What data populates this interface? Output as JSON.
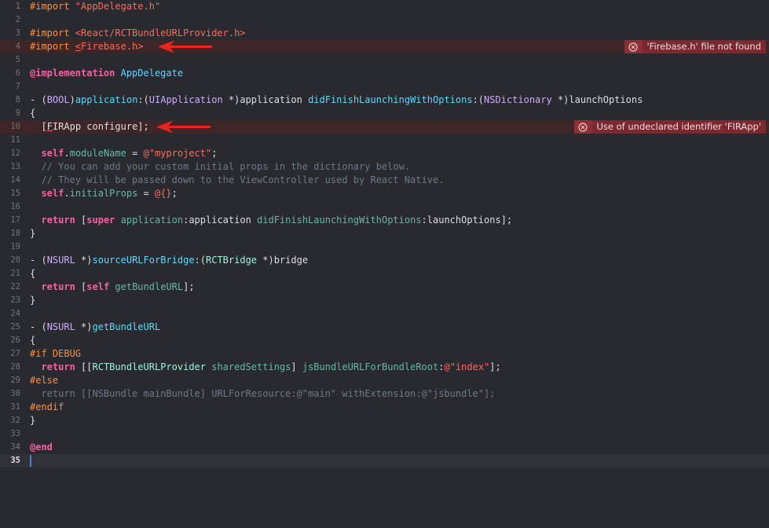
{
  "editor": {
    "lines": [
      {
        "n": "1",
        "tokens": [
          {
            "t": "#import ",
            "c": "pp"
          },
          {
            "t": "\"AppDelegate.h\"",
            "c": "str"
          }
        ]
      },
      {
        "n": "2",
        "tokens": []
      },
      {
        "n": "3",
        "tokens": [
          {
            "t": "#import ",
            "c": "pp"
          },
          {
            "t": "<React/RCTBundleURLProvider.h>",
            "c": "str"
          }
        ]
      },
      {
        "n": "4",
        "error": "'Firebase.h' file not found",
        "tokens": [
          {
            "t": "#import ",
            "c": "pp"
          },
          {
            "t": "<",
            "c": "str umark"
          },
          {
            "t": "Firebase.h>",
            "c": "str"
          }
        ]
      },
      {
        "n": "5",
        "tokens": []
      },
      {
        "n": "6",
        "tokens": [
          {
            "t": "@implementation ",
            "c": "kw"
          },
          {
            "t": "AppDelegate",
            "c": "cls"
          }
        ]
      },
      {
        "n": "7",
        "tokens": []
      },
      {
        "n": "8",
        "tokens": [
          {
            "t": "- (",
            "c": "plain"
          },
          {
            "t": "BOOL",
            "c": "type"
          },
          {
            "t": ")",
            "c": "plain"
          },
          {
            "t": "application",
            "c": "cls"
          },
          {
            "t": ":(",
            "c": "plain"
          },
          {
            "t": "UIApplication",
            "c": "type"
          },
          {
            "t": " *)application ",
            "c": "plain"
          },
          {
            "t": "didFinishLaunchingWithOptions",
            "c": "cls"
          },
          {
            "t": ":(",
            "c": "plain"
          },
          {
            "t": "NSDictionary",
            "c": "type"
          },
          {
            "t": " *)launchOptions",
            "c": "plain"
          }
        ]
      },
      {
        "n": "9",
        "tokens": [
          {
            "t": "{",
            "c": "plain"
          }
        ]
      },
      {
        "n": "10",
        "error": "Use of undeclared identifier 'FIRApp'",
        "tokens": [
          {
            "t": "  [",
            "c": "plain"
          },
          {
            "t": "F",
            "c": "plain umark"
          },
          {
            "t": "IRApp configure];",
            "c": "plain"
          }
        ]
      },
      {
        "n": "11",
        "tokens": []
      },
      {
        "n": "12",
        "tokens": [
          {
            "t": "  ",
            "c": "plain"
          },
          {
            "t": "self",
            "c": "kw"
          },
          {
            "t": ".",
            "c": "plain"
          },
          {
            "t": "moduleName",
            "c": "meth"
          },
          {
            "t": " = ",
            "c": "plain"
          },
          {
            "t": "@\"myproject\"",
            "c": "str"
          },
          {
            "t": ";",
            "c": "plain"
          }
        ]
      },
      {
        "n": "13",
        "tokens": [
          {
            "t": "  // You can add your custom initial props in the dictionary below.",
            "c": "cmt"
          }
        ]
      },
      {
        "n": "14",
        "tokens": [
          {
            "t": "  // They will be passed down to the ViewController used by React Native.",
            "c": "cmt"
          }
        ]
      },
      {
        "n": "15",
        "tokens": [
          {
            "t": "  ",
            "c": "plain"
          },
          {
            "t": "self",
            "c": "kw"
          },
          {
            "t": ".",
            "c": "plain"
          },
          {
            "t": "initialProps",
            "c": "meth"
          },
          {
            "t": " = ",
            "c": "plain"
          },
          {
            "t": "@{}",
            "c": "str"
          },
          {
            "t": ";",
            "c": "plain"
          }
        ]
      },
      {
        "n": "16",
        "tokens": []
      },
      {
        "n": "17",
        "tokens": [
          {
            "t": "  ",
            "c": "plain"
          },
          {
            "t": "return",
            "c": "kw"
          },
          {
            "t": " [",
            "c": "plain"
          },
          {
            "t": "super",
            "c": "kw"
          },
          {
            "t": " ",
            "c": "plain"
          },
          {
            "t": "application",
            "c": "meth"
          },
          {
            "t": ":application ",
            "c": "plain"
          },
          {
            "t": "didFinishLaunchingWithOptions",
            "c": "meth"
          },
          {
            "t": ":launchOptions];",
            "c": "plain"
          }
        ]
      },
      {
        "n": "18",
        "tokens": [
          {
            "t": "}",
            "c": "plain"
          }
        ]
      },
      {
        "n": "19",
        "tokens": []
      },
      {
        "n": "20",
        "tokens": [
          {
            "t": "- (",
            "c": "plain"
          },
          {
            "t": "NSURL",
            "c": "type"
          },
          {
            "t": " *)",
            "c": "plain"
          },
          {
            "t": "sourceURLForBridge",
            "c": "cls"
          },
          {
            "t": ":(",
            "c": "plain"
          },
          {
            "t": "RCTBridge",
            "c": "rcls"
          },
          {
            "t": " *)bridge",
            "c": "plain"
          }
        ]
      },
      {
        "n": "21",
        "tokens": [
          {
            "t": "{",
            "c": "plain"
          }
        ]
      },
      {
        "n": "22",
        "tokens": [
          {
            "t": "  ",
            "c": "plain"
          },
          {
            "t": "return",
            "c": "kw"
          },
          {
            "t": " [",
            "c": "plain"
          },
          {
            "t": "self",
            "c": "kw"
          },
          {
            "t": " ",
            "c": "plain"
          },
          {
            "t": "getBundleURL",
            "c": "meth"
          },
          {
            "t": "];",
            "c": "plain"
          }
        ]
      },
      {
        "n": "23",
        "tokens": [
          {
            "t": "}",
            "c": "plain"
          }
        ]
      },
      {
        "n": "24",
        "tokens": []
      },
      {
        "n": "25",
        "tokens": [
          {
            "t": "- (",
            "c": "plain"
          },
          {
            "t": "NSURL",
            "c": "type"
          },
          {
            "t": " *)",
            "c": "plain"
          },
          {
            "t": "getBundleURL",
            "c": "cls"
          }
        ]
      },
      {
        "n": "26",
        "tokens": [
          {
            "t": "{",
            "c": "plain"
          }
        ]
      },
      {
        "n": "27",
        "tokens": [
          {
            "t": "#if DEBUG",
            "c": "pp"
          }
        ]
      },
      {
        "n": "28",
        "tokens": [
          {
            "t": "  ",
            "c": "plain"
          },
          {
            "t": "return",
            "c": "kw"
          },
          {
            "t": " [[",
            "c": "plain"
          },
          {
            "t": "RCTBundleURLProvider",
            "c": "rcls"
          },
          {
            "t": " ",
            "c": "plain"
          },
          {
            "t": "sharedSettings",
            "c": "meth"
          },
          {
            "t": "] ",
            "c": "plain"
          },
          {
            "t": "jsBundleURLForBundleRoot",
            "c": "meth"
          },
          {
            "t": ":",
            "c": "plain"
          },
          {
            "t": "@\"index\"",
            "c": "str"
          },
          {
            "t": "];",
            "c": "plain"
          }
        ]
      },
      {
        "n": "29",
        "tokens": [
          {
            "t": "#else",
            "c": "pp"
          }
        ]
      },
      {
        "n": "30",
        "tokens": [
          {
            "t": "  return [[NSBundle mainBundle] URLForResource:",
            "c": "cmt"
          },
          {
            "t": "@\"main\"",
            "c": "cmt"
          },
          {
            "t": " withExtension:",
            "c": "cmt"
          },
          {
            "t": "@\"jsbundle\"",
            "c": "cmt"
          },
          {
            "t": "];",
            "c": "cmt"
          }
        ]
      },
      {
        "n": "31",
        "tokens": [
          {
            "t": "#endif",
            "c": "pp"
          }
        ]
      },
      {
        "n": "32",
        "tokens": [
          {
            "t": "}",
            "c": "plain"
          }
        ]
      },
      {
        "n": "33",
        "tokens": []
      },
      {
        "n": "34",
        "tokens": [
          {
            "t": "@end",
            "c": "kw"
          }
        ]
      },
      {
        "n": "35",
        "current": true,
        "tokens": []
      }
    ]
  },
  "colors": {
    "background": "#292a30",
    "error_line": "#3e2628",
    "error_badge": "#7a2930",
    "annotation_arrow": "#e8251f"
  },
  "annotations": {
    "arrow_lines": [
      "4",
      "10"
    ],
    "error_icon": "error-circle-x-icon",
    "arrow_icon": "red-left-arrow-icon"
  }
}
